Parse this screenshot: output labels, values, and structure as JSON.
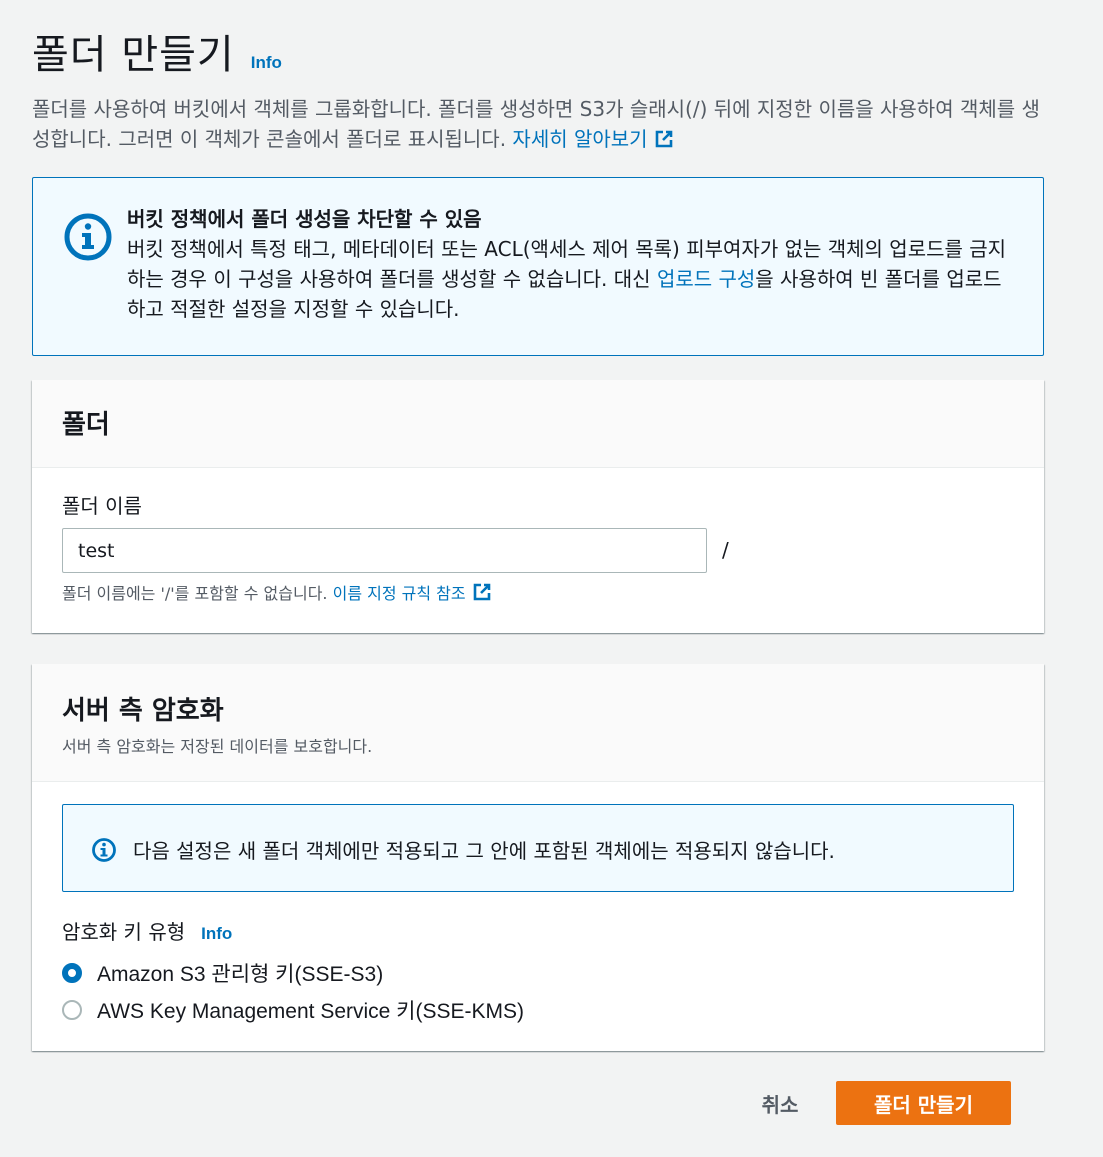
{
  "header": {
    "title": "폴더 만들기",
    "info_label": "Info"
  },
  "description": {
    "text": "폴더를 사용하여 버킷에서 객체를 그룹화합니다. 폴더를 생성하면 S3가 슬래시(/) 뒤에 지정한 이름을 사용하여 객체를 생성합니다. 그러면 이 객체가 콘솔에서 폴더로 표시됩니다.",
    "link_label": "자세히 알아보기"
  },
  "alert": {
    "title": "버킷 정책에서 폴더 생성을 차단할 수 있음",
    "text_before_link": "버킷 정책에서 특정 태그, 메타데이터 또는 ACL(액세스 제어 목록) 피부여자가 없는 객체의 업로드를 금지하는 경우 이 구성을 사용하여 폴더를 생성할 수 없습니다. 대신 ",
    "link_label": "업로드 구성",
    "text_after_link": "을 사용하여 빈 폴더를 업로드하고 적절한 설정을 지정할 수 있습니다."
  },
  "folder_panel": {
    "title": "폴더",
    "field_label": "폴더 이름",
    "field_value": "test",
    "suffix": "/",
    "hint_text": "폴더 이름에는 '/'를 포함할 수 없습니다. ",
    "hint_link": "이름 지정 규칙 참조"
  },
  "encryption_panel": {
    "title": "서버 측 암호화",
    "subtitle": "서버 측 암호화는 저장된 데이터를 보호합니다.",
    "notice": "다음 설정은 새 폴더 객체에만 적용되고 그 안에 포함된 객체에는 적용되지 않습니다.",
    "key_type_label": "암호화 키 유형",
    "info_label": "Info",
    "options": [
      {
        "label": "Amazon S3 관리형 키(SSE-S3)",
        "selected": true
      },
      {
        "label": "AWS Key Management Service 키(SSE-KMS)",
        "selected": false
      }
    ]
  },
  "actions": {
    "cancel_label": "취소",
    "create_label": "폴더 만들기"
  },
  "colors": {
    "link": "#0073bb",
    "primary": "#ec7211",
    "alert_bg": "#f1faff",
    "page_bg": "#f2f3f3"
  },
  "icons": {
    "external": "external-link-icon",
    "info": "info-circle-icon"
  }
}
